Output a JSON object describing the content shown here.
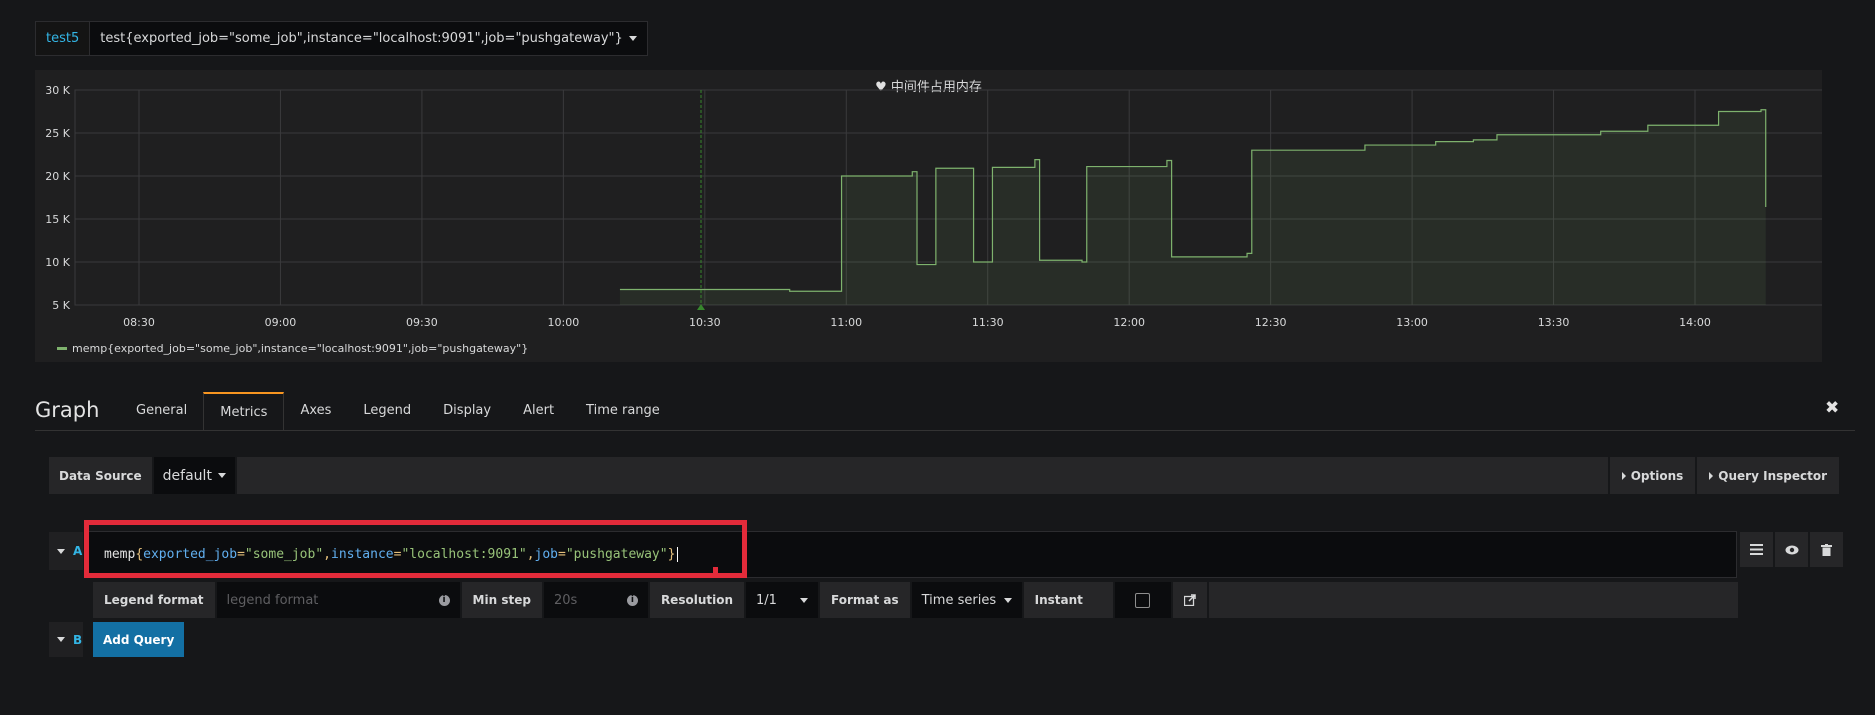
{
  "variable_bar": {
    "label": "test5",
    "value": "test{exported_job=\"some_job\",instance=\"localhost:9091\",job=\"pushgateway\"}"
  },
  "panel": {
    "title": "中间件占用内存",
    "legend_label": "memp{exported_job=\"some_job\",instance=\"localhost:9091\",job=\"pushgateway\"}",
    "series_color": "#7eb26d"
  },
  "chart_data": {
    "type": "line",
    "title": "中间件占用内存",
    "y_ticks": [
      "30 K",
      "25 K",
      "20 K",
      "15 K",
      "10 K",
      "5 K"
    ],
    "x_ticks": [
      "08:30",
      "09:00",
      "09:30",
      "10:00",
      "10:30",
      "11:00",
      "11:30",
      "12:00",
      "12:30",
      "13:00",
      "13:30",
      "14:00"
    ],
    "ylim": [
      5000,
      30000
    ],
    "grid": true,
    "legend_placement": "bottom-left",
    "series": [
      {
        "name": "memp{exported_job=\"some_job\",instance=\"localhost:9091\",job=\"pushgateway\"}",
        "points": [
          [
            "10:12",
            6800
          ],
          [
            "10:35",
            6800
          ],
          [
            "10:48",
            6600
          ],
          [
            "10:58",
            6600
          ],
          [
            "10:59",
            20000
          ],
          [
            "11:14",
            20500
          ],
          [
            "11:15",
            9700
          ],
          [
            "11:18",
            9700
          ],
          [
            "11:19",
            20900
          ],
          [
            "11:26",
            20900
          ],
          [
            "11:27",
            10000
          ],
          [
            "11:31",
            21000
          ],
          [
            "11:40",
            21900
          ],
          [
            "11:41",
            10200
          ],
          [
            "11:50",
            10000
          ],
          [
            "11:51",
            21100
          ],
          [
            "12:08",
            21800
          ],
          [
            "12:09",
            10600
          ],
          [
            "12:25",
            11000
          ],
          [
            "12:26",
            23000
          ],
          [
            "12:50",
            23600
          ],
          [
            "13:05",
            24000
          ],
          [
            "13:13",
            24200
          ],
          [
            "13:18",
            24800
          ],
          [
            "13:40",
            25200
          ],
          [
            "13:50",
            25900
          ],
          [
            "14:05",
            27500
          ],
          [
            "14:14",
            27700
          ],
          [
            "14:15",
            16400
          ]
        ]
      }
    ]
  },
  "editor": {
    "title": "Graph",
    "tabs": [
      "General",
      "Metrics",
      "Axes",
      "Legend",
      "Display",
      "Alert",
      "Time range"
    ],
    "active_tab": "Metrics"
  },
  "datasource": {
    "label": "Data Source",
    "value": "default",
    "options_btn": "Options",
    "inspector_btn": "Query Inspector"
  },
  "query_a": {
    "ref": "A",
    "metric": "memp",
    "labels": [
      {
        "key": "exported_job",
        "value": "\"some_job\""
      },
      {
        "key": "instance",
        "value": "\"localhost:9091\""
      },
      {
        "key": "job",
        "value": "\"pushgateway\""
      }
    ],
    "legend_format_label": "Legend format",
    "legend_format_placeholder": "legend format",
    "min_step_label": "Min step",
    "min_step_placeholder": "20s",
    "resolution_label": "Resolution",
    "resolution_value": "1/1",
    "format_as_label": "Format as",
    "format_as_value": "Time series",
    "instant_label": "Instant"
  },
  "query_b": {
    "ref": "B",
    "add_label": "Add Query"
  },
  "icons": {
    "heart": "♥",
    "close": "✖",
    "info": "i"
  }
}
